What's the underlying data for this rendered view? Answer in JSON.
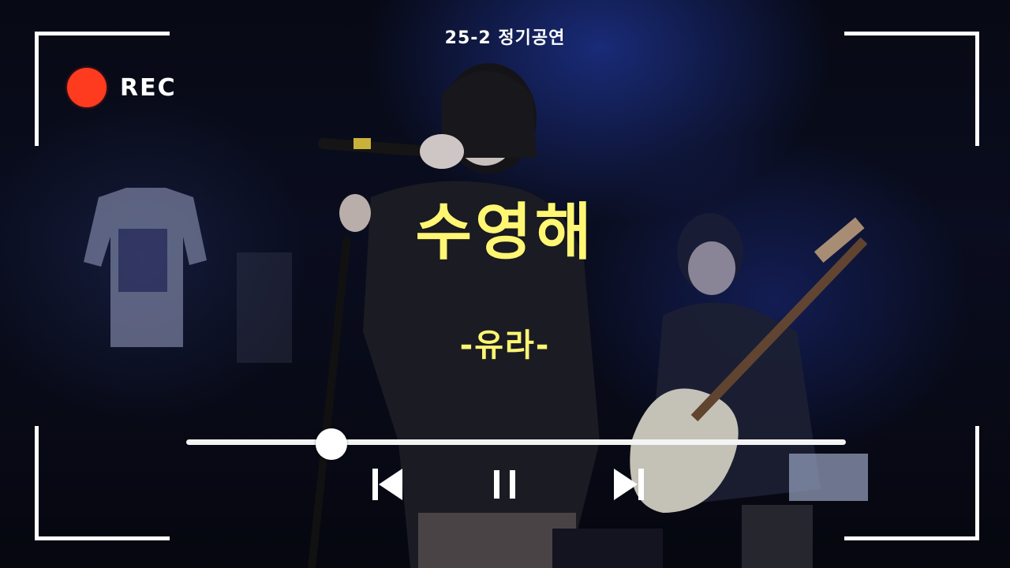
{
  "event": {
    "title": "25-2 정기공연"
  },
  "recording": {
    "label": "REC",
    "dot_color": "#ff3b1f"
  },
  "song": {
    "title": "수영해",
    "performer": "-유라-",
    "title_color": "#fff673"
  },
  "player": {
    "progress": 0.22,
    "controls": [
      {
        "name": "previous",
        "icon": "skip-previous-icon"
      },
      {
        "name": "pause",
        "icon": "pause-icon"
      },
      {
        "name": "next",
        "icon": "skip-next-icon"
      }
    ]
  }
}
